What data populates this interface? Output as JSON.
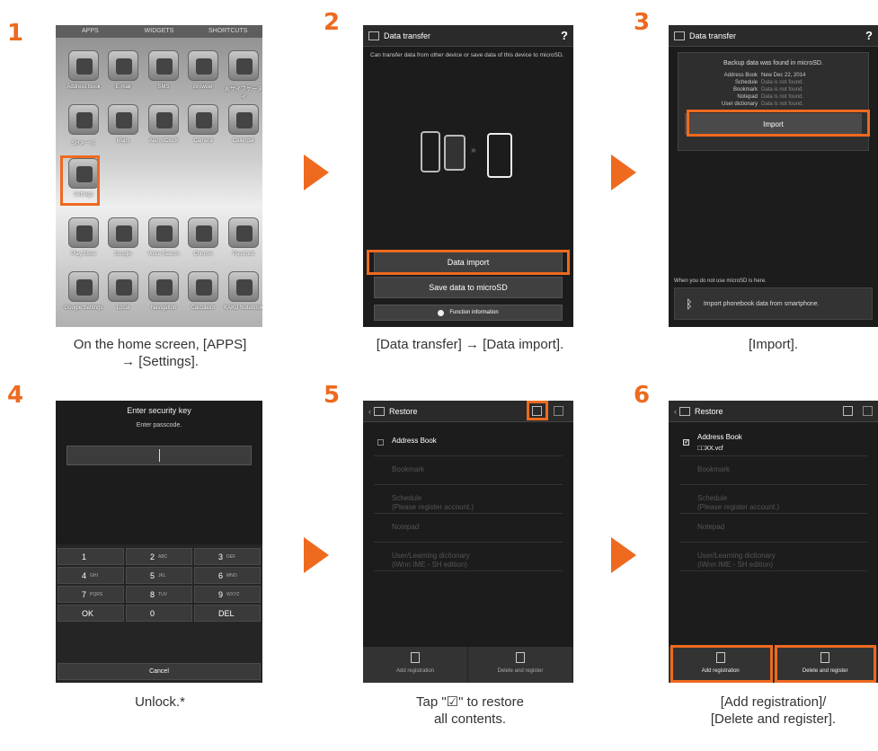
{
  "steps": [
    {
      "num": "1",
      "caption": "On the home screen, [APPS]\n→ [Settings]."
    },
    {
      "num": "2",
      "caption": "[Data transfer] → [Data import]."
    },
    {
      "num": "3",
      "caption": "[Import]."
    },
    {
      "num": "4",
      "caption": "Unlock.*"
    },
    {
      "num": "5",
      "caption": "Tap \"☑\" to restore\nall contents."
    },
    {
      "num": "6",
      "caption": "[Add registration]/\n[Delete and register]."
    }
  ],
  "screen1": {
    "tabs": [
      "APPS",
      "WIDGETS",
      "SHORTCUTS"
    ],
    "apps": [
      "Address Book",
      "E-mail",
      "SMS",
      "Browser",
      "おサイフケータイ",
      "SHメール",
      "Maps",
      "Alarm/Clock",
      "Camera",
      "Calendar",
      "Settings",
      "Play Store",
      "Google",
      "Voice Search",
      "Chrome",
      "Passtock",
      "Google Settings",
      "Local",
      "Navigation",
      "Calculator",
      "KAKU Notebook"
    ]
  },
  "screen2": {
    "title": "Data transfer",
    "help": "?",
    "description": "Can transfer data from other device or save data of this device to microSD.",
    "import_label": "Data import",
    "save_label": "Save data to microSD",
    "info_label": "Function information"
  },
  "screen3": {
    "title": "Data transfer",
    "help": "?",
    "found": "Backup data was found in microSD.",
    "rows": [
      {
        "key": "Address Book",
        "value": "New Dec 22, 2014"
      },
      {
        "key": "Schedule",
        "value": "Data is not found."
      },
      {
        "key": "Bookmark",
        "value": "Data is not found."
      },
      {
        "key": "Notepad",
        "value": "Data is not found."
      },
      {
        "key": "User dictionary",
        "value": "Data is not found."
      }
    ],
    "import_label": "Import",
    "microsd_note": "When you do not use microSD is here.",
    "phonebook_label": "Import phonebook data from smartphone."
  },
  "screen4": {
    "title": "Enter security key",
    "prompt": "Enter passcode.",
    "keys": [
      {
        "main": "1",
        "sub": ""
      },
      {
        "main": "2",
        "sub": "ABC"
      },
      {
        "main": "3",
        "sub": "DEF"
      },
      {
        "main": "4",
        "sub": "GHI"
      },
      {
        "main": "5",
        "sub": "JKL"
      },
      {
        "main": "6",
        "sub": "MNO"
      },
      {
        "main": "7",
        "sub": "PQRS"
      },
      {
        "main": "8",
        "sub": "TUV"
      },
      {
        "main": "9",
        "sub": "WXYZ"
      },
      {
        "main": "OK",
        "sub": ""
      },
      {
        "main": "0",
        "sub": ""
      },
      {
        "main": "DEL",
        "sub": ""
      }
    ],
    "cancel": "Cancel"
  },
  "screen5": {
    "title": "Restore",
    "rows": [
      "Address Book",
      "Bookmark",
      "Schedule\n(Please register account.)",
      "Notepad",
      "User/Learning dictionary\n(iWnn IME - SH edition)"
    ],
    "add_label": "Add registration",
    "delete_label": "Delete and register"
  },
  "screen6": {
    "title": "Restore",
    "rows": [
      "Address Book",
      "Bookmark",
      "Schedule\n(Please register account.)",
      "Notepad",
      "User/Learning dictionary\n(iWnn IME - SH edition)"
    ],
    "address_sub": "□□XX.vcf",
    "add_label": "Add registration",
    "delete_label": "Delete and register"
  }
}
